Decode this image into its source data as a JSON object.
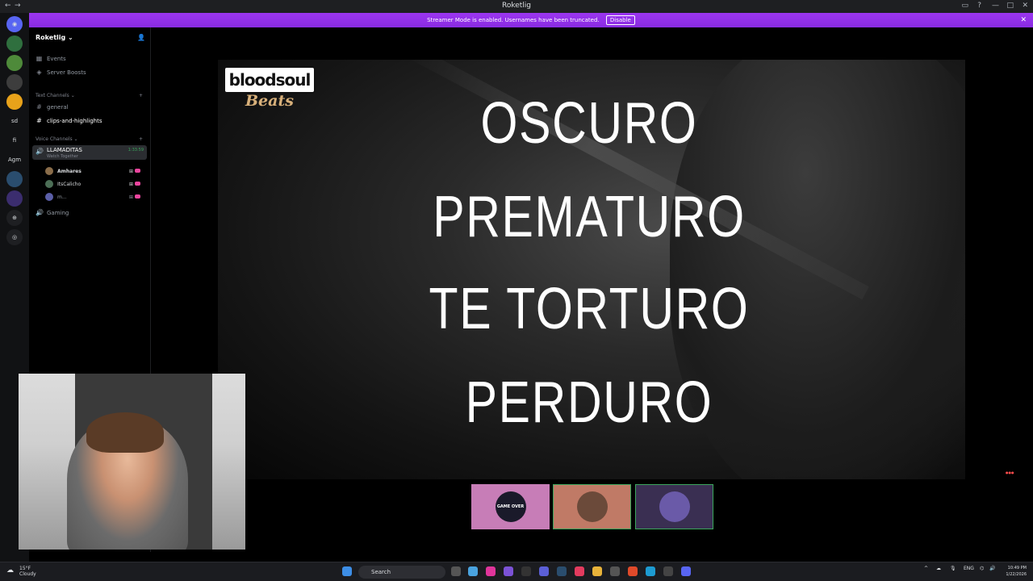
{
  "window": {
    "title": "Roketlig"
  },
  "banner": {
    "text": "Streamer Mode is enabled. Usernames have been truncated.",
    "disable_label": "Disable"
  },
  "guild_labels": [
    "sd",
    "fi",
    "Agm"
  ],
  "server": {
    "name": "Roketlig",
    "items": [
      {
        "label": "Events"
      },
      {
        "label": "Server Boosts"
      }
    ],
    "text_category": "Text Channels",
    "text_channels": [
      {
        "label": "general"
      },
      {
        "label": "clips-and-highlights"
      }
    ],
    "voice_category": "Voice Channels",
    "voice_channel": {
      "name": "LLAMADITAS",
      "subtitle": "Watch Together",
      "elapsed": "1:33:59"
    },
    "voice_members": [
      {
        "name": "Amhares"
      },
      {
        "name": "ItsCalicho"
      },
      {
        "name": "m..."
      }
    ],
    "other_voice": [
      {
        "label": "Gaming"
      }
    ]
  },
  "stage": {
    "logo_text": "bloodsoul",
    "logo_sub": "Beats",
    "lyrics": [
      "OSCURO",
      "PREMATURO",
      "TE TORTURO",
      "PERDURO"
    ],
    "tiles": [
      {
        "avatar_text": "GAME OVER",
        "bg": "#c77db7"
      },
      {
        "avatar_text": "",
        "bg": "#c07a66"
      },
      {
        "avatar_text": "",
        "bg": "#3a2f52"
      }
    ]
  },
  "taskbar": {
    "weather_temp": "15°F",
    "weather_desc": "Cloudy",
    "search_label": "Search",
    "tray_lang": "ENG",
    "clock_time": "10:49 PM",
    "clock_date": "1/22/2026"
  },
  "colors": {
    "banner": "#8a2be2",
    "voice_green": "#3ba55c",
    "sidebar_bg": "#000000",
    "accent_pink": "#eb459e"
  }
}
